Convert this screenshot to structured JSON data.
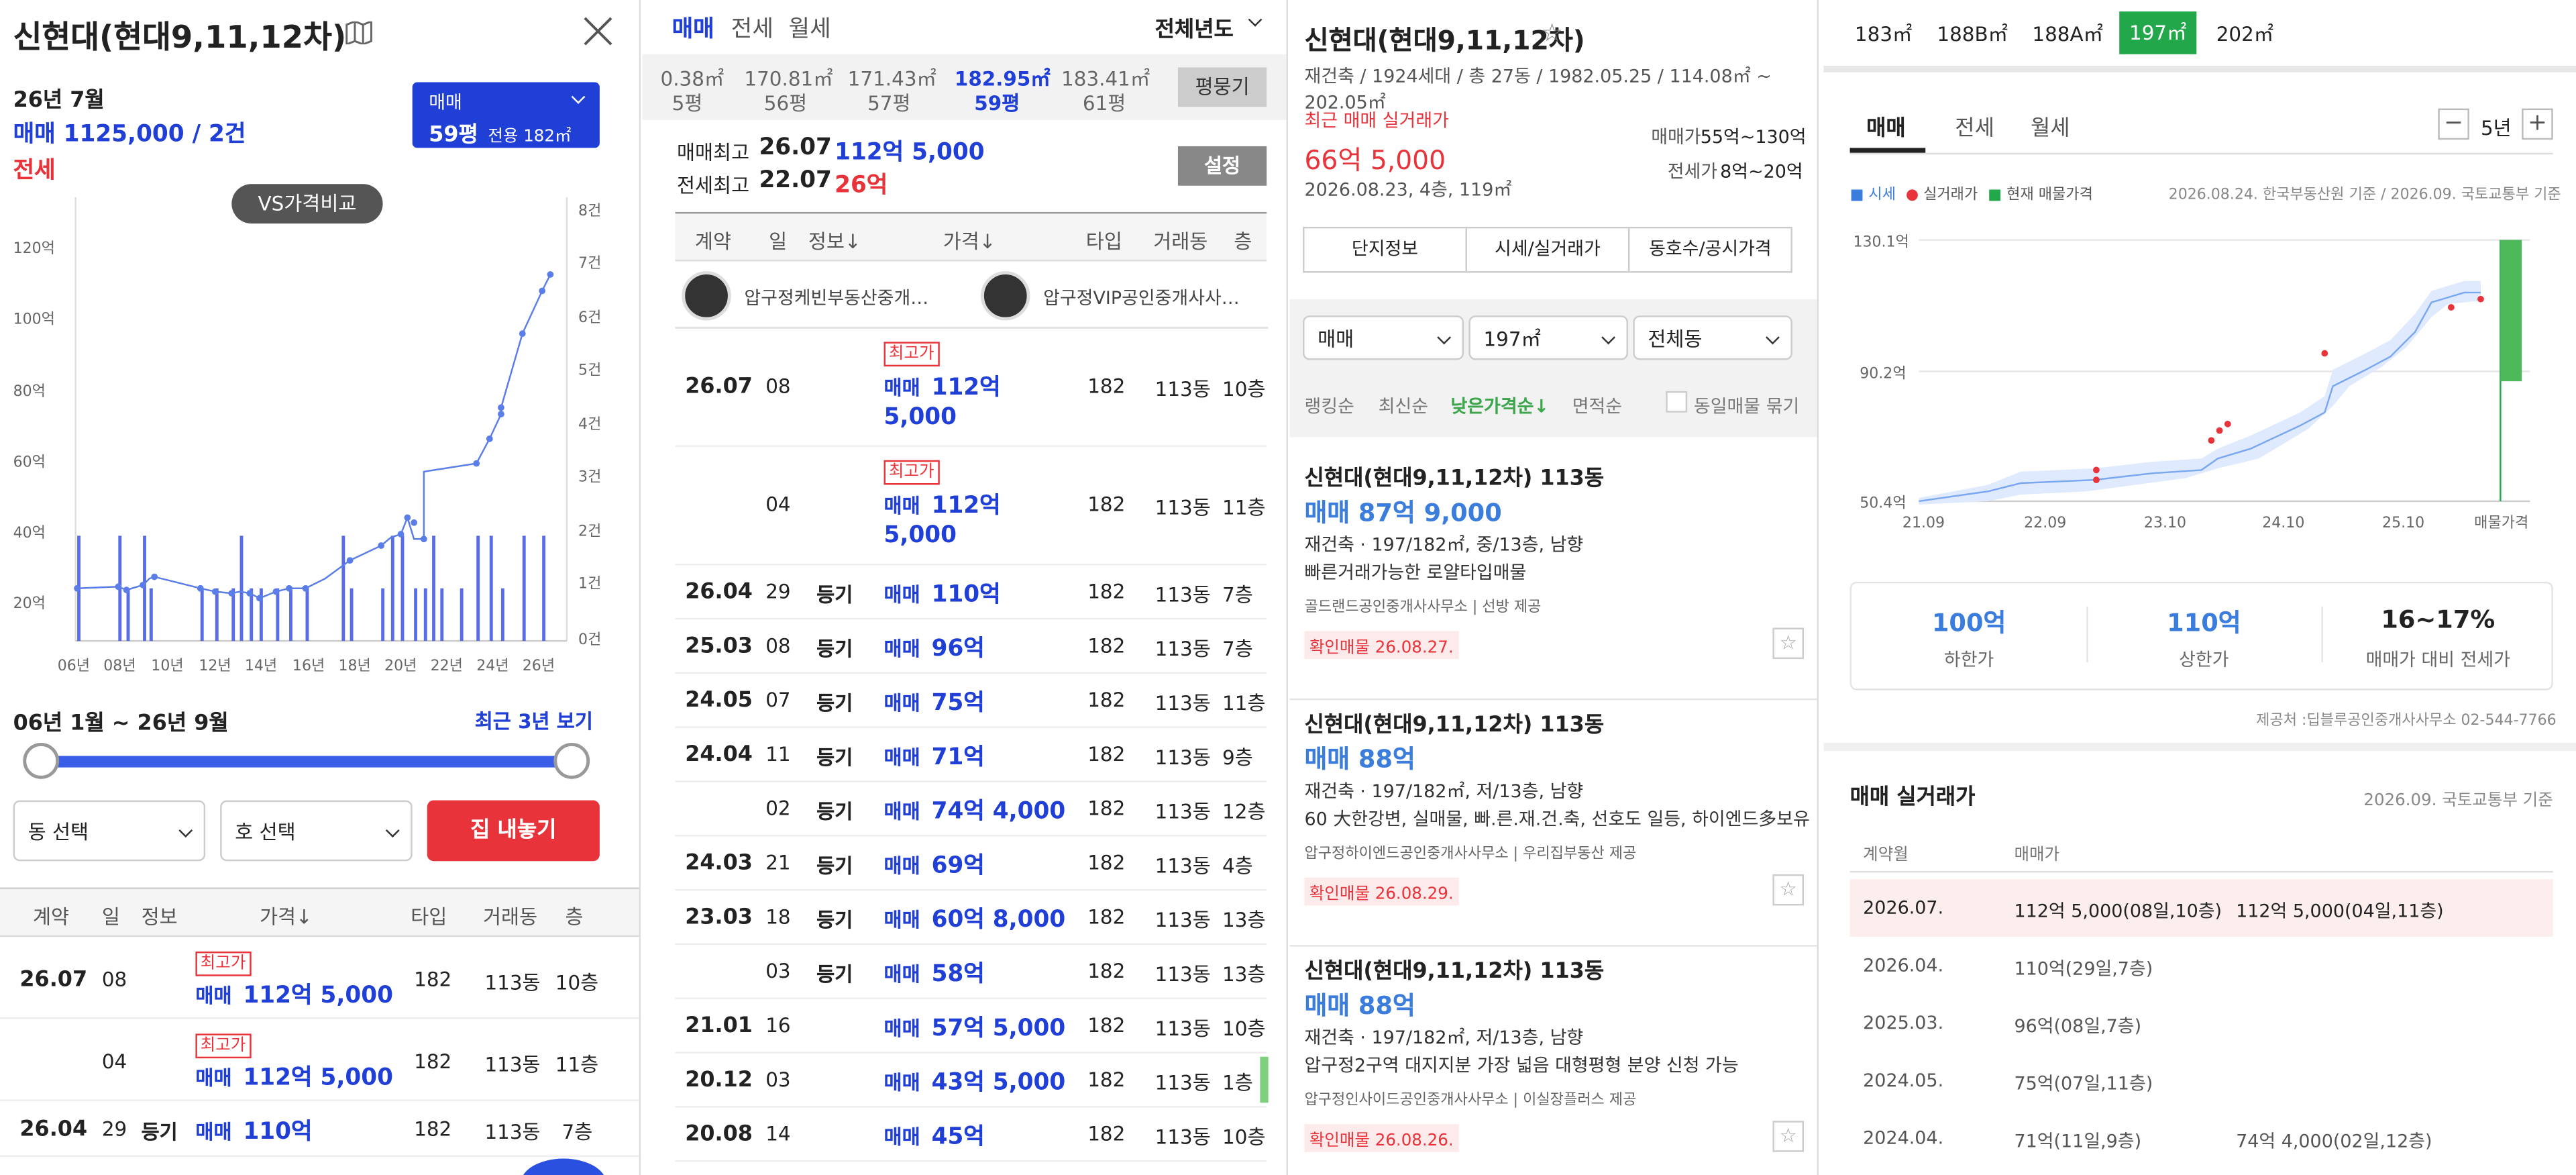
{
  "p1": {
    "title": "신현대(현대9,11,12차)",
    "date_label": "26년 7월",
    "sale_line": "매매 1125,000 / 2건",
    "jeonse_label": "전세",
    "type_box": {
      "label": "매매",
      "pyeong": "59평",
      "exclusive": "전용 182㎡"
    },
    "vs_button": "VS가격비교",
    "y_left_ticks": [
      "120억",
      "100억",
      "80억",
      "60억",
      "40억",
      "20억"
    ],
    "y_right_ticks": [
      "8건",
      "7건",
      "6건",
      "5건",
      "4건",
      "3건",
      "2건",
      "1건",
      "0건"
    ],
    "x_ticks": [
      "06년",
      "08년",
      "10년",
      "12년",
      "14년",
      "16년",
      "18년",
      "20년",
      "22년",
      "24년",
      "26년"
    ],
    "range_label": "06년 1월 ~ 26년 9월",
    "recent_link": "최근 3년 보기",
    "dong_select": "동 선택",
    "ho_select": "호 선택",
    "list_button": "집 내놓기",
    "table_headers": [
      "계약",
      "일",
      "정보",
      "가격↓",
      "타입",
      "거래동",
      "층"
    ],
    "rows": [
      {
        "ym": "26.07",
        "day": "08",
        "info": "",
        "badge": "최고가",
        "price_prefix": "매매",
        "price": "112억 5,000",
        "type": "182",
        "dong": "113동",
        "floor": "10층"
      },
      {
        "ym": "",
        "day": "04",
        "info": "",
        "badge": "최고가",
        "price_prefix": "매매",
        "price": "112억 5,000",
        "type": "182",
        "dong": "113동",
        "floor": "11층"
      },
      {
        "ym": "26.04",
        "day": "29",
        "info": "등기",
        "badge": "",
        "price_prefix": "매매",
        "price": "110억",
        "type": "182",
        "dong": "113동",
        "floor": "7층"
      }
    ]
  },
  "p2": {
    "tabs": [
      "매매",
      "전세",
      "월세"
    ],
    "year_filter": "전체년도",
    "areas": [
      {
        "m2": "0.38㎡",
        "py": "5평"
      },
      {
        "m2": "170.81㎡",
        "py": "56평"
      },
      {
        "m2": "171.43㎡",
        "py": "57평"
      },
      {
        "m2": "182.95㎡",
        "py": "59평"
      },
      {
        "m2": "183.41㎡",
        "py": "61평"
      }
    ],
    "pyeong_button": "평뭉기",
    "max_sale": {
      "label": "매매최고",
      "date": "26.07",
      "price": "112억 5,000"
    },
    "max_jeonse": {
      "label": "전세최고",
      "date": "22.07",
      "price": "26억"
    },
    "settings_button": "설정",
    "table_headers": [
      "계약",
      "일",
      "정보↓",
      "가격↓",
      "타입",
      "거래동",
      "층"
    ],
    "agents": [
      "압구정케빈부동산중개…",
      "압구정VIP공인중개사사…"
    ],
    "rows": [
      {
        "ym": "26.07",
        "day": "08",
        "info": "",
        "badge": "최고가",
        "prefix": "매매",
        "price": "112억",
        "price2": "5,000",
        "type": "182",
        "dong": "113동",
        "floor": "10층"
      },
      {
        "ym": "",
        "day": "04",
        "info": "",
        "badge": "최고가",
        "prefix": "매매",
        "price": "112억",
        "price2": "5,000",
        "type": "182",
        "dong": "113동",
        "floor": "11층"
      },
      {
        "ym": "26.04",
        "day": "29",
        "info": "등기",
        "badge": "",
        "prefix": "매매",
        "price": "110억",
        "price2": "",
        "type": "182",
        "dong": "113동",
        "floor": "7층"
      },
      {
        "ym": "25.03",
        "day": "08",
        "info": "등기",
        "badge": "",
        "prefix": "매매",
        "price": "96억",
        "price2": "",
        "type": "182",
        "dong": "113동",
        "floor": "7층"
      },
      {
        "ym": "24.05",
        "day": "07",
        "info": "등기",
        "badge": "",
        "prefix": "매매",
        "price": "75억",
        "price2": "",
        "type": "182",
        "dong": "113동",
        "floor": "11층"
      },
      {
        "ym": "24.04",
        "day": "11",
        "info": "등기",
        "badge": "",
        "prefix": "매매",
        "price": "71억",
        "price2": "",
        "type": "182",
        "dong": "113동",
        "floor": "9층"
      },
      {
        "ym": "",
        "day": "02",
        "info": "등기",
        "badge": "",
        "prefix": "매매",
        "price": "74억 4,000",
        "price2": "",
        "type": "182",
        "dong": "113동",
        "floor": "12층"
      },
      {
        "ym": "24.03",
        "day": "21",
        "info": "등기",
        "badge": "",
        "prefix": "매매",
        "price": "69억",
        "price2": "",
        "type": "182",
        "dong": "113동",
        "floor": "4층"
      },
      {
        "ym": "23.03",
        "day": "18",
        "info": "등기",
        "badge": "",
        "prefix": "매매",
        "price": "60억 8,000",
        "price2": "",
        "type": "182",
        "dong": "113동",
        "floor": "13층"
      },
      {
        "ym": "",
        "day": "03",
        "info": "등기",
        "badge": "",
        "prefix": "매매",
        "price": "58억",
        "price2": "",
        "type": "182",
        "dong": "113동",
        "floor": "13층"
      },
      {
        "ym": "21.01",
        "day": "16",
        "info": "",
        "badge": "",
        "prefix": "매매",
        "price": "57억 5,000",
        "price2": "",
        "type": "182",
        "dong": "113동",
        "floor": "10층"
      },
      {
        "ym": "20.12",
        "day": "03",
        "info": "",
        "badge": "",
        "prefix": "매매",
        "price": "43억 5,000",
        "price2": "",
        "type": "182",
        "dong": "113동",
        "floor": "1층"
      },
      {
        "ym": "20.08",
        "day": "14",
        "info": "",
        "badge": "",
        "prefix": "매매",
        "price": "45억",
        "price2": "",
        "type": "182",
        "dong": "113동",
        "floor": "10층"
      }
    ]
  },
  "p3": {
    "title": "신현대(현대9,11,12차)",
    "subtitle": "재건축 / 1924세대 / 총 27동 / 1982.05.25 / 114.08㎡ ~ 202.05㎡",
    "recent_label": "최근 매매 실거래가",
    "recent_price": "66억 5,000",
    "recent_detail": "2026.08.23, 4층, 119㎡",
    "sale_range_label": "매매가",
    "sale_range": "55억~130억",
    "jeonse_range_label": "전세가",
    "jeonse_range": "8억~20억",
    "tabs": [
      "단지정보",
      "시세/실거래가",
      "동호수/공시가격"
    ],
    "filters": [
      "매매",
      "197㎡",
      "전체동"
    ],
    "sorts": [
      "랭킹순",
      "최신순",
      "낮은가격순↓",
      "면적순"
    ],
    "group_label": "동일매물 묶기",
    "listings": [
      {
        "title": "신현대(현대9,11,12차) 113동",
        "price": "매매 87억 9,000",
        "spec": "재건축 · 197/182㎡, 중/13층, 남향",
        "desc": "빠른거래가능한 로얄타입매물",
        "agent": "골드랜드공인중개사사무소 | 선방 제공",
        "confirm": "확인매물 26.08.27."
      },
      {
        "title": "신현대(현대9,11,12차) 113동",
        "price": "매매 88억",
        "spec": "재건축 · 197/182㎡, 저/13층, 남향",
        "desc": "60 大한강변, 실매물, 빠.른.재.건.축, 선호도 일등, 하이엔드多보유",
        "agent": "압구정하이엔드공인중개사사무소 | 우리집부동산 제공",
        "confirm": "확인매물 26.08.29."
      },
      {
        "title": "신현대(현대9,11,12차) 113동",
        "price": "매매 88억",
        "spec": "재건축 · 197/182㎡, 저/13층, 남향",
        "desc": "압구정2구역 대지지분 가장 넓음 대형평형 분양 신청 가능",
        "agent": "압구정인사이드공인중개사사무소 | 이실장플러스 제공",
        "confirm": "확인매물 26.08.26."
      }
    ]
  },
  "p4": {
    "area_tabs": [
      "183㎡",
      "188B㎡",
      "188A㎡",
      "197㎡",
      "202㎡"
    ],
    "active_area": "197㎡",
    "tabs": [
      "매매",
      "전세",
      "월세"
    ],
    "period": "5년",
    "legend": [
      "시세",
      "실거래가",
      "현재 매물가격"
    ],
    "basis": "2026.08.24. 한국부동산원 기준 / 2026.09. 국토교통부 기준",
    "y_ticks": [
      "130.1억",
      "90.2억",
      "50.4억"
    ],
    "x_ticks": [
      "21.09",
      "22.09",
      "23.10",
      "24.10",
      "25.10",
      "매물가격"
    ],
    "stats": [
      {
        "value": "100억",
        "label": "하한가"
      },
      {
        "value": "110억",
        "label": "상한가"
      },
      {
        "value": "16~17%",
        "label": "매매가 대비 전세가"
      }
    ],
    "provider": "제공처 :딥블루공인중개사사무소 02-544-7766",
    "deal_title": "매매 실거래가",
    "deal_basis": "2026.09. 국토교통부 기준",
    "deal_headers": [
      "계약월",
      "매매가"
    ],
    "deals": [
      {
        "month": "2026.07.",
        "price": "112억 5,000(08일,10층)",
        "price2": "112억 5,000(04일,11층)"
      },
      {
        "month": "2026.04.",
        "price": "110억(29일,7층)",
        "price2": ""
      },
      {
        "month": "2025.03.",
        "price": "96억(08일,7층)",
        "price2": ""
      },
      {
        "month": "2024.05.",
        "price": "75억(07일,11층)",
        "price2": ""
      },
      {
        "month": "2024.04.",
        "price": "71억(11일,9층)",
        "price2": "74억 4,000(02일,12층)"
      }
    ]
  }
}
